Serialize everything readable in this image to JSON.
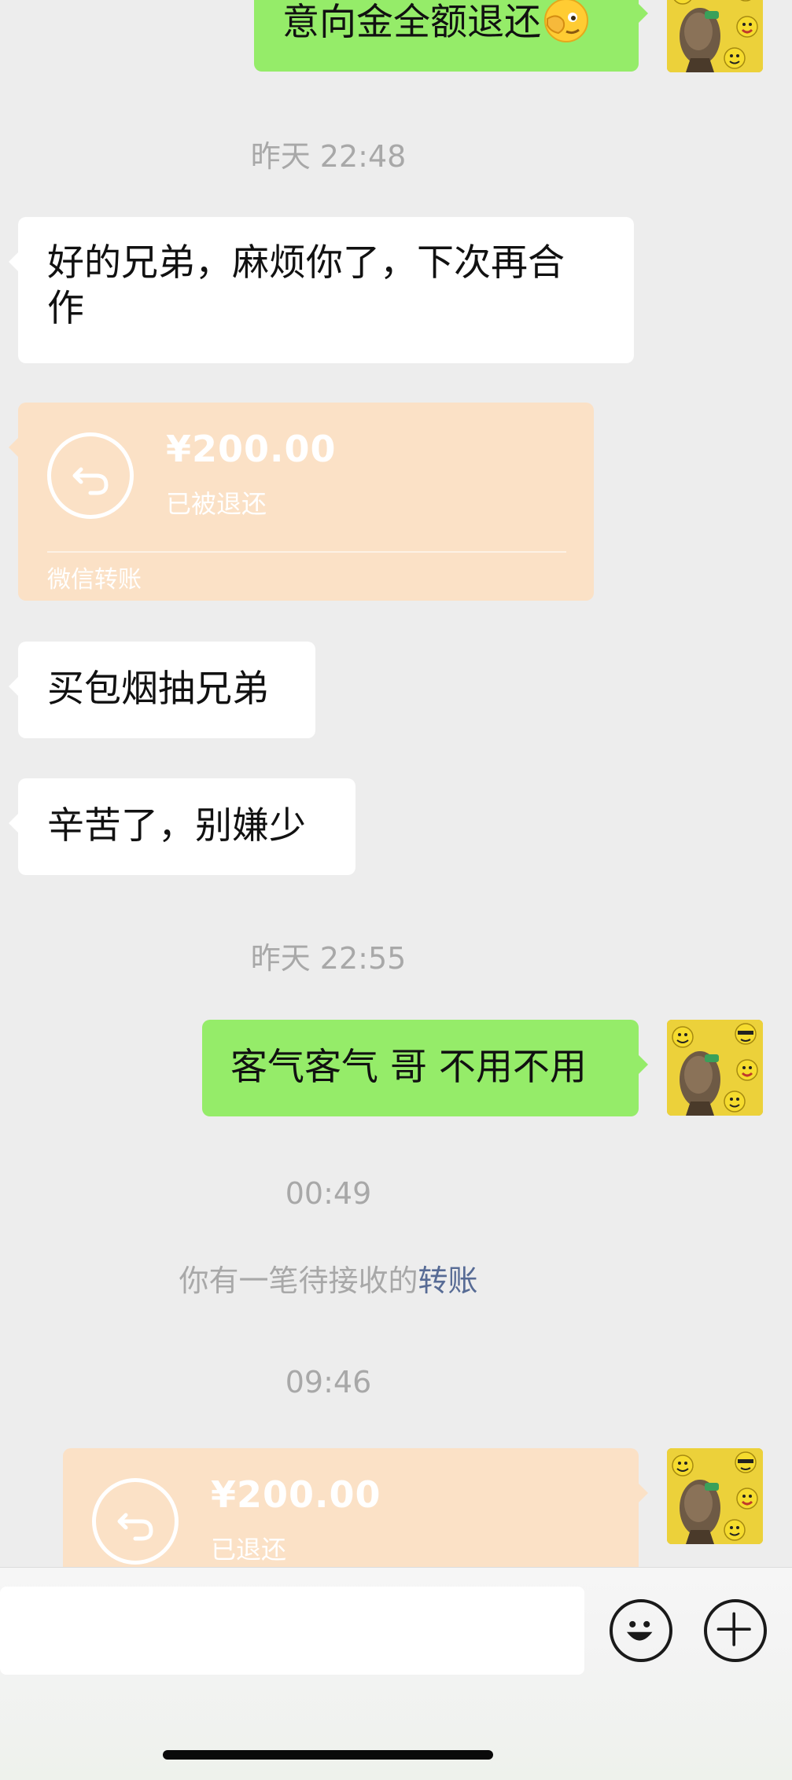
{
  "messages": {
    "m1": "意向金全额退还",
    "t1": "昨天 22:48",
    "m2_line1": "好的兄弟，麻烦你了，下次再合",
    "m2_line2": "作",
    "transfer1": {
      "amount": "¥200.00",
      "status": "已被退还",
      "brand": "微信转账"
    },
    "m3": "买包烟抽兄弟",
    "m4": "辛苦了，别嫌少",
    "t2": "昨天 22:55",
    "m5": "客气客气 哥 不用不用",
    "t3": "00:49",
    "sys_prefix": "你有一笔待接收的",
    "sys_link": "转账",
    "t4": "09:46",
    "transfer2": {
      "amount": "¥200.00",
      "status": "已退还"
    }
  },
  "icons": {
    "emoji_peek": "face-with-hand-over-eye-emoji",
    "emoji_button": "smile-face-icon",
    "plus_button": "plus-circle-icon",
    "refund": "return-arrow-icon"
  },
  "colors": {
    "bg": "#ededed",
    "incoming": "#ffffff",
    "outgoing": "#95ec69",
    "transfer": "#fbe1c6",
    "link": "#576b95"
  }
}
